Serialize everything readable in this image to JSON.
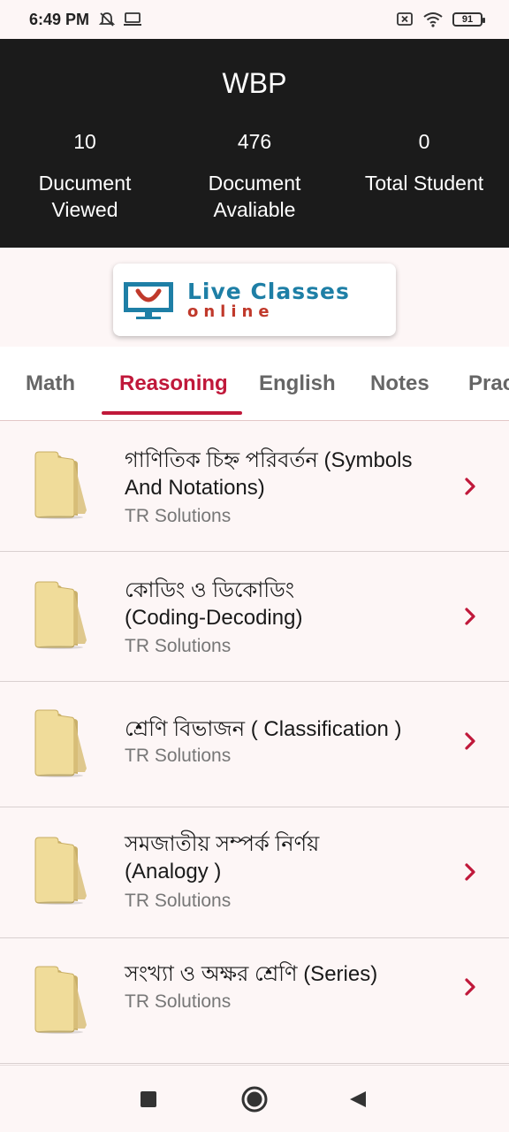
{
  "status_bar": {
    "time": "6:49 PM",
    "battery": "91",
    "icons": [
      "bell-off-icon",
      "laptop-icon",
      "sim-x-icon",
      "wifi-icon",
      "battery-icon"
    ]
  },
  "header": {
    "title": "WBP",
    "stats": [
      {
        "value": "10",
        "label_line1": "Ducument",
        "label_line2": "Viewed"
      },
      {
        "value": "476",
        "label_line1": "Document",
        "label_line2": "Avaliable"
      },
      {
        "value": "0",
        "label_line1": "Total Student",
        "label_line2": ""
      }
    ]
  },
  "banner": {
    "line1": "Live Classes",
    "line2": "online"
  },
  "tabs": [
    {
      "label": "Math"
    },
    {
      "label": "Reasoning",
      "active": true
    },
    {
      "label": "English"
    },
    {
      "label": "Notes"
    },
    {
      "label": "Prac"
    }
  ],
  "items": [
    {
      "title_line1": "গাণিতিক চিহ্ন পরিবর্তন (Symbols",
      "title_line2": "And Notations)",
      "subtitle": "TR Solutions"
    },
    {
      "title_line1": "কোডিং ও ডিকোডিং",
      "title_line2": "(Coding-Decoding)",
      "subtitle": "TR Solutions"
    },
    {
      "title_line1": "শ্রেণি বিভাজন ( Classification )",
      "title_line2": "",
      "subtitle": "TR Solutions"
    },
    {
      "title_line1": "সমজাতীয় সম্পর্ক নির্ণয়",
      "title_line2": "(Analogy )",
      "subtitle": "TR Solutions"
    },
    {
      "title_line1": "সংখ্যা ও অক্ষর শ্রেণি  (Series)",
      "title_line2": "",
      "subtitle": "TR Solutions"
    }
  ],
  "colors": {
    "accent": "#c0183a",
    "header_bg": "#1b1b1b",
    "page_bg": "#fdf6f6"
  }
}
